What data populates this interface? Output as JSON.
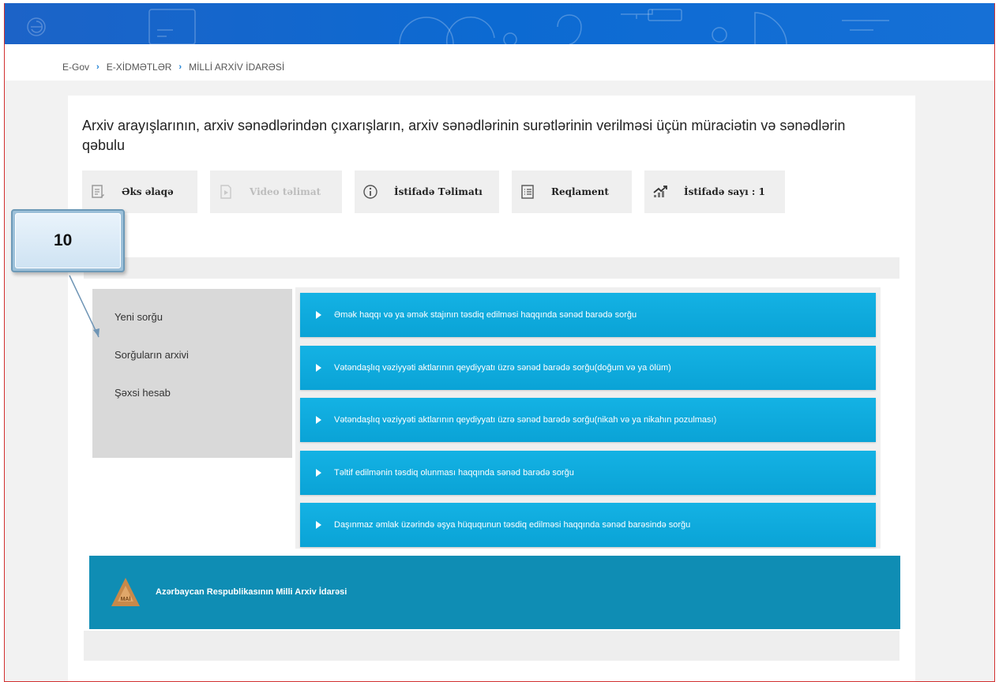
{
  "breadcrumb": [
    "E-Gov",
    "E-XİDMƏTLƏR",
    "MİLLİ ARXİV İDARƏSİ"
  ],
  "page_title": "Arxiv arayışlarının, arxiv sənədlərindən çıxarışların, arxiv sənədlərinin surətlərinin verilməsi üçün müraciətin və sənədlərin qəbulu",
  "toolbar": {
    "contact": "Əks əlaqə",
    "video": "Video təlimat",
    "instructions": "İstifadə Təlimatı",
    "regulation": "Reqlament",
    "usage": "İstifadə sayı : 1"
  },
  "sidebar": {
    "items": [
      "Yeni sorğu",
      "Sorğuların arxivi",
      "Şəxsi hesab"
    ]
  },
  "services": [
    "Əmək haqqı və ya əmək stajının təsdiq edilməsi haqqında sənəd barədə sorğu",
    "Vətəndaşlıq vəziyyəti aktlarının qeydiyyatı üzrə sənəd barədə sorğu(doğum və ya ölüm)",
    "Vətəndaşlıq vəziyyəti aktlarının qeydiyyatı üzrə sənəd barədə sorğu(nikah və ya nikahın pozulması)",
    "Təltif edilmənin təsdiq olunması haqqında sənəd barədə sorğu",
    "Daşınmaz əmlak üzərində əşya hüququnun təsdiq edilməsi haqqında sənəd barəsində sorğu"
  ],
  "footer": {
    "logo_text": "MAİ",
    "org_name": "Azərbaycan Respublikasının Milli Arxiv İdarəsi"
  },
  "callout": {
    "number": "10"
  },
  "colors": {
    "header_blue": "#1c63c7",
    "service_blue": "#0aa3d6",
    "footer_teal": "#0f8db4",
    "breadcrumb_accent": "#1a7fd4"
  }
}
